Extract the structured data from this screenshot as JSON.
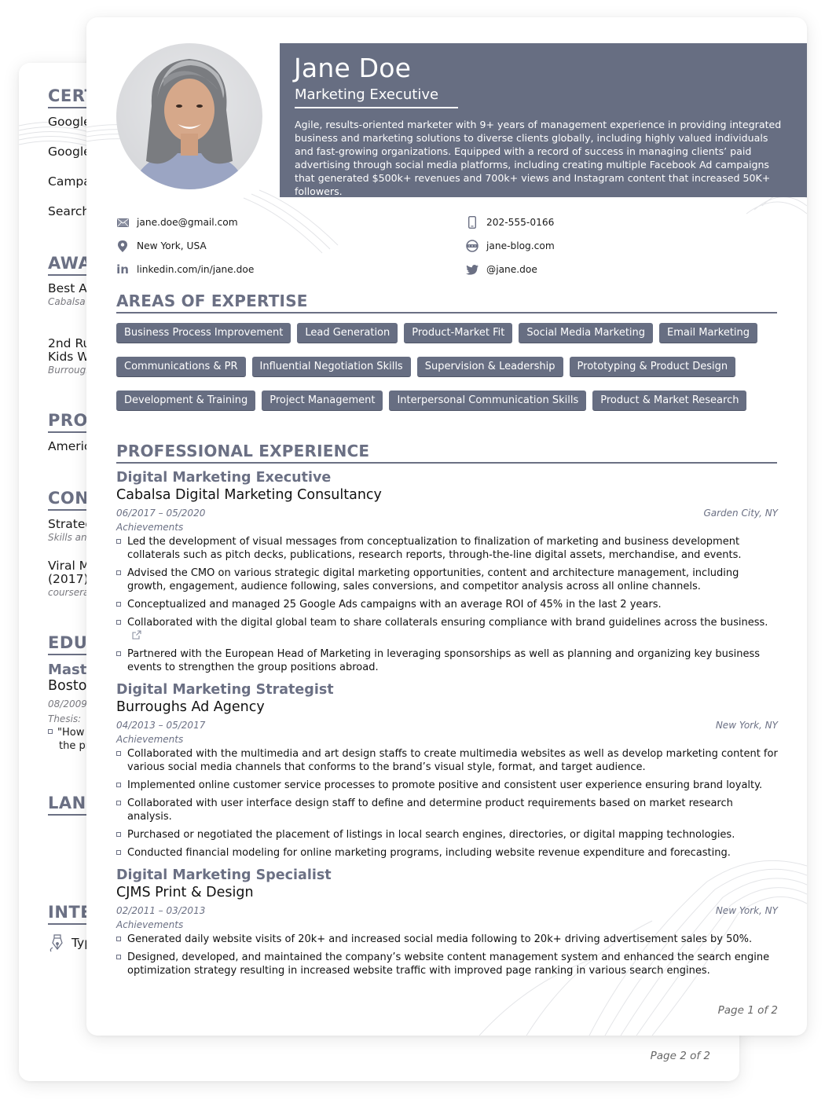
{
  "back_page": {
    "sections": {
      "certifications": {
        "heading": "CERTIFICATIONS",
        "items": [
          "Google",
          "Google",
          "Campa",
          "Search"
        ]
      },
      "awards": {
        "heading": "AWARDS",
        "items": [
          {
            "title": "Best Ad",
            "sub": "Cabalsa D"
          },
          {
            "title_lines": [
              "2nd Ru",
              "Kids W"
            ],
            "sub": "Burrough"
          }
        ]
      },
      "professional": {
        "heading": "PROFESSIONAL",
        "items": [
          "Americ"
        ]
      },
      "conferences": {
        "heading": "CONFERENCES",
        "items": [
          {
            "title": "Strateg",
            "sub": "Skills and"
          },
          {
            "title_lines": [
              "Viral M",
              "(2017)"
            ],
            "sub": "coursera."
          }
        ]
      },
      "education": {
        "heading": "EDUCATION",
        "degree": "Maste",
        "school": "Bosto",
        "dates": "08/2009",
        "thesis_label": "Thesis:",
        "thesis_lines": [
          "\"How",
          "the pr"
        ]
      },
      "languages": {
        "heading": "LANGUAGES"
      },
      "interests": {
        "heading": "INTERESTS",
        "items": [
          {
            "icon": "fountain-pen-icon",
            "label": "Typ"
          }
        ]
      }
    },
    "page_number": "Page 2 of 2"
  },
  "profile": {
    "name": "Jane Doe",
    "role": "Marketing Executive",
    "summary": "Agile, results-oriented marketer with 9+ years of management experience in providing integrated business and marketing solutions to diverse clients globally, including highly valued individuals and fast-growing organizations. Equipped with a record of success in managing clients’ paid advertising through social media platforms, including creating multiple Facebook Ad campaigns that generated $500k+ revenues and 700k+ views and Instagram content that increased 50K+ followers."
  },
  "contacts": {
    "email": {
      "icon": "envelope-icon",
      "value": "jane.doe@gmail.com"
    },
    "location": {
      "icon": "map-pin-icon",
      "value": "New York, USA"
    },
    "linkedin": {
      "icon": "linkedin-icon",
      "value": "linkedin.com/in/jane.doe"
    },
    "phone": {
      "icon": "mobile-phone-icon",
      "value": "202-555-0166"
    },
    "website": {
      "icon": "globe-icon",
      "value": "jane-blog.com"
    },
    "twitter": {
      "icon": "twitter-icon",
      "value": "@jane.doe"
    }
  },
  "expertise": {
    "heading": "AREAS OF EXPERTISE",
    "rows": [
      [
        "Business Process Improvement",
        "Lead Generation",
        "Product-Market Fit",
        "Social Media Marketing",
        "Email Marketing"
      ],
      [
        "Communications & PR",
        "Influential Negotiation Skills",
        "Supervision & Leadership",
        "Prototyping & Product Design"
      ],
      [
        "Development & Training",
        "Project Management",
        "Interpersonal Communication Skills",
        "Product & Market Research"
      ]
    ]
  },
  "experience": {
    "heading": "PROFESSIONAL EXPERIENCE",
    "jobs": [
      {
        "title": "Digital Marketing Executive",
        "company": "Cabalsa Digital Marketing Consultancy",
        "dates": "06/2017 – 05/2020",
        "location": "Garden City, NY",
        "achievements_label": "Achievements",
        "bullets": [
          "Led the development of visual messages from conceptualization to finalization of marketing and business development collaterals such as pitch decks, publications, research reports, through-the-line digital assets, merchandise, and events.",
          "Advised the CMO on various strategic digital marketing opportunities, content and architecture management, including growth, engagement, audience following, sales conversions, and competitor analysis across all online channels.",
          "Conceptualized and managed 25 Google Ads campaigns with an average ROI of 45% in the last 2 years.",
          "Collaborated with the digital global team to share collaterals ensuring compliance with brand guidelines across the business.",
          "Partnered with the European Head of Marketing in leveraging sponsorships as well as planning and organizing key business events to strengthen the group positions abroad."
        ]
      },
      {
        "title": "Digital Marketing Strategist",
        "company": "Burroughs Ad Agency",
        "dates": "04/2013 – 05/2017",
        "location": "New York, NY",
        "achievements_label": "Achievements",
        "bullets": [
          "Collaborated with the multimedia and art design staffs to create multimedia websites as well as develop marketing content for various social media channels that conforms to the brand’s visual style, format, and target audience.",
          "Implemented online customer service processes to promote positive and consistent user experience ensuring brand loyalty.",
          "Collaborated with user interface design staff to define and determine product requirements based on market research analysis.",
          "Purchased or negotiated the placement of listings in local search engines, directories, or digital mapping technologies.",
          "Conducted financial modeling for online marketing programs, including website revenue expenditure and forecasting."
        ]
      },
      {
        "title": "Digital Marketing Specialist",
        "company": "CJMS Print & Design",
        "dates": "02/2011 – 03/2013",
        "location": "New York, NY",
        "achievements_label": "Achievements",
        "bullets": [
          "Generated daily website visits of 20k+ and increased social media following to 20k+ driving advertisement sales by 50%.",
          "Designed, developed, and maintained the company’s website content management system and enhanced the search engine optimization strategy resulting in increased website traffic with improved page ranking in various search engines."
        ]
      }
    ]
  },
  "page_number": "Page 1 of 2",
  "colors": {
    "accent": "#676e82",
    "heading": "#6b7084",
    "text": "#111111"
  }
}
